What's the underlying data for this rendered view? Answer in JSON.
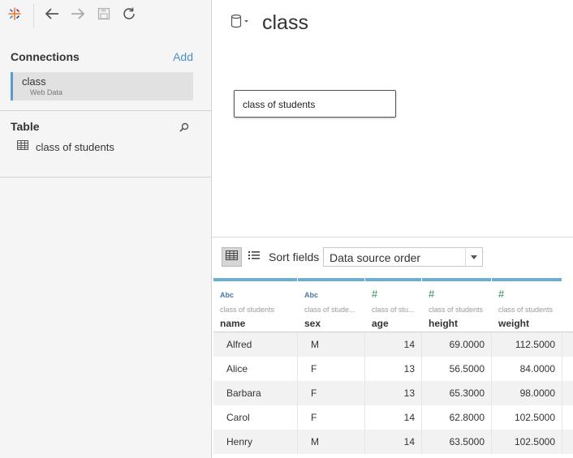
{
  "connections": {
    "title": "Connections",
    "add_label": "Add",
    "items": [
      {
        "name": "class",
        "type": "Web Data"
      }
    ]
  },
  "table_section": {
    "title": "Table",
    "items": [
      {
        "label": "class of students"
      }
    ]
  },
  "datasource": {
    "title": "class"
  },
  "canvas": {
    "table_label": "class of students"
  },
  "grid_toolbar": {
    "sort_label": "Sort fields",
    "sort_value": "Data source order"
  },
  "grid": {
    "columns": [
      {
        "type": "Abc",
        "source": "class of students",
        "name": "name"
      },
      {
        "type": "Abc",
        "source": "class of stude...",
        "name": "sex"
      },
      {
        "type": "#",
        "source": "class of stu...",
        "name": "age"
      },
      {
        "type": "#",
        "source": "class of students",
        "name": "height"
      },
      {
        "type": "#",
        "source": "class of students",
        "name": "weight"
      }
    ],
    "rows": [
      [
        "Alfred",
        "M",
        "14",
        "69.0000",
        "112.5000"
      ],
      [
        "Alice",
        "F",
        "13",
        "56.5000",
        "84.0000"
      ],
      [
        "Barbara",
        "F",
        "13",
        "65.3000",
        "98.0000"
      ],
      [
        "Carol",
        "F",
        "14",
        "62.8000",
        "102.5000"
      ],
      [
        "Henry",
        "M",
        "14",
        "63.5000",
        "102.5000"
      ]
    ]
  },
  "colors": {
    "accent": "#5b9bd5",
    "link": "#4a90c8",
    "numeric_type": "#2e8b57",
    "string_type": "#4a79a5"
  }
}
